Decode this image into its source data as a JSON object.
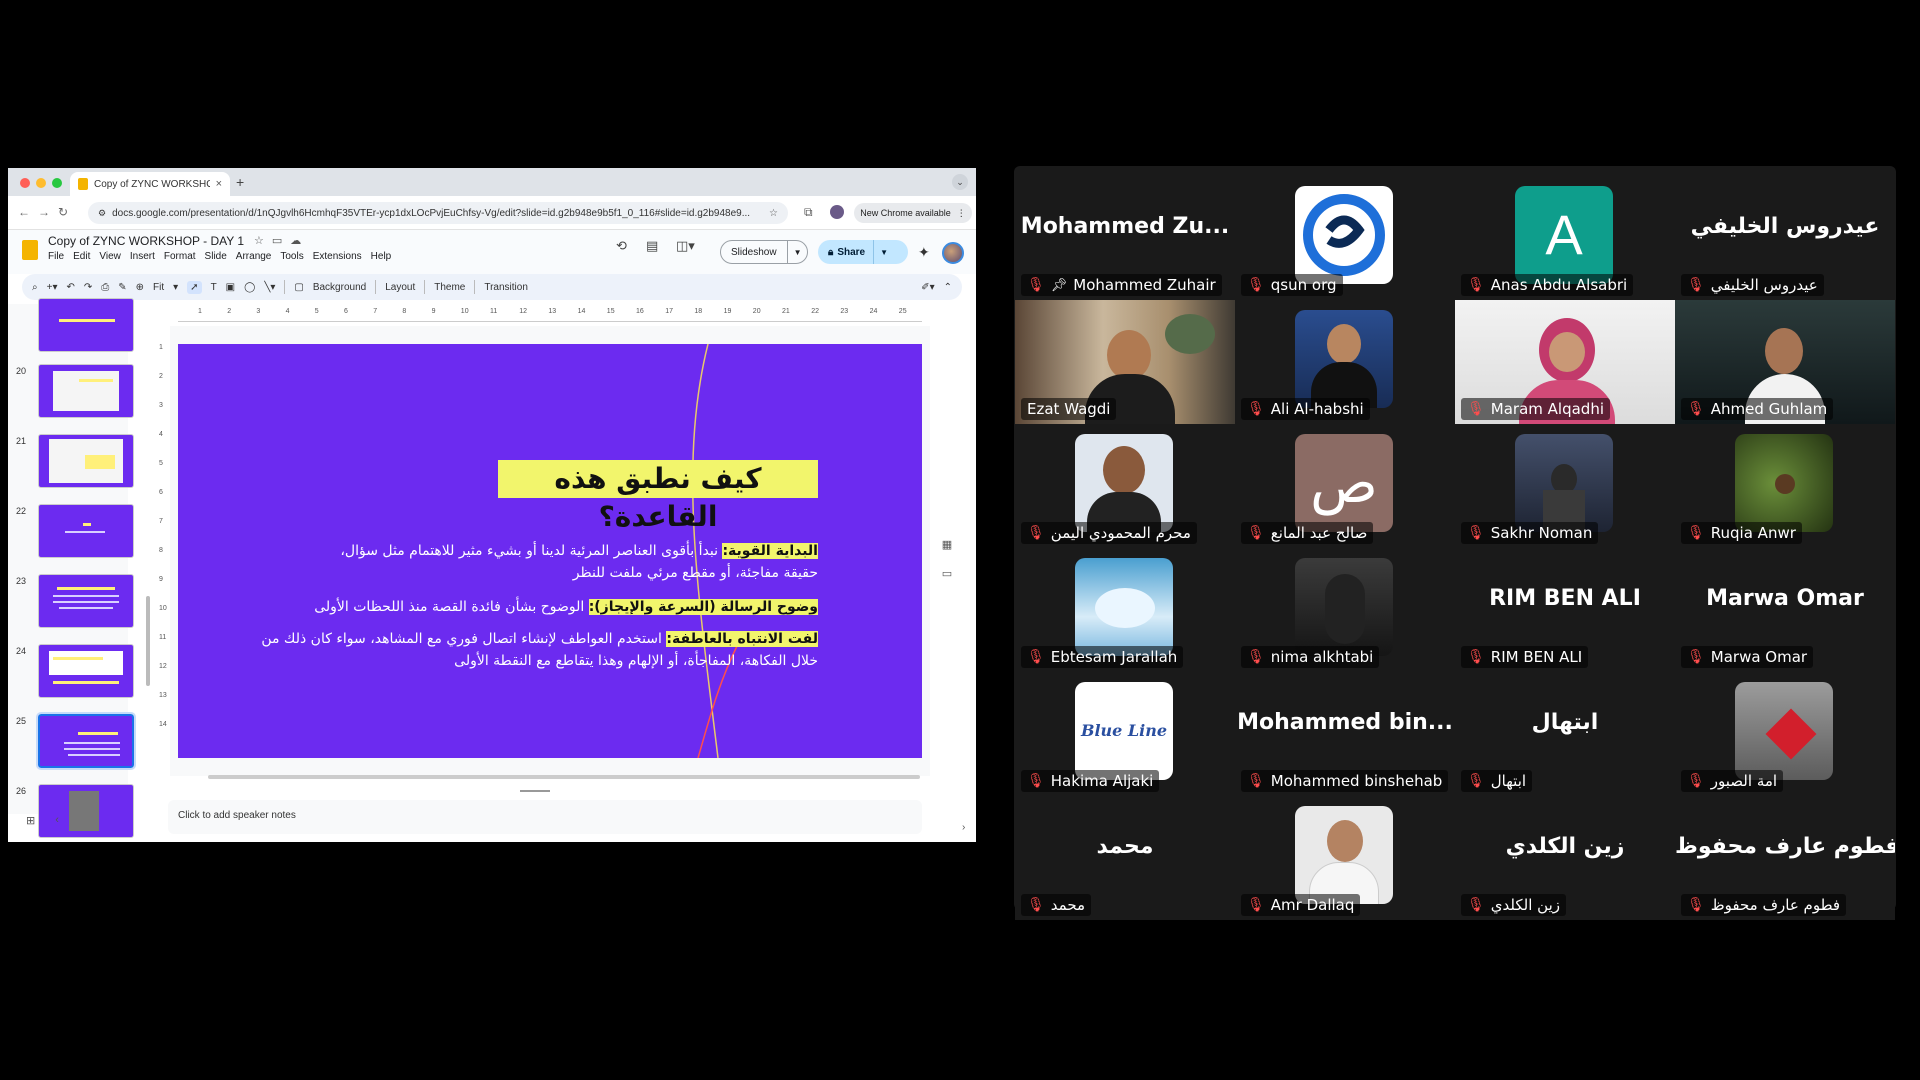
{
  "browser": {
    "tab_title": "Copy of ZYNC WORKSHOP",
    "tab_close": "×",
    "new_tab": "+",
    "url": "docs.google.com/presentation/d/1nQJgvlh6HcmhqF35VTEr-ycp1dxLOcPvjEuChfsy-Vg/edit?slide=id.g2b948e9b5f1_0_116#slide=id.g2b948e9...",
    "update_pill": "New Chrome available",
    "back": "←",
    "forward": "→",
    "reload": "↻"
  },
  "slides_app": {
    "doc_title": "Copy of ZYNC WORKSHOP - DAY 1",
    "menu": [
      "File",
      "Edit",
      "View",
      "Insert",
      "Format",
      "Slide",
      "Arrange",
      "Tools",
      "Extensions",
      "Help"
    ],
    "slideshow_label": "Slideshow",
    "share_label": "Share",
    "toolbar": {
      "zoom": "Fit",
      "background": "Background",
      "layout": "Layout",
      "theme": "Theme",
      "transition": "Transition"
    },
    "ruler_h": [
      "1",
      "2",
      "3",
      "4",
      "5",
      "6",
      "7",
      "8",
      "9",
      "10",
      "11",
      "12",
      "13",
      "14",
      "15",
      "16",
      "17",
      "18",
      "19",
      "20",
      "21",
      "22",
      "23",
      "24",
      "25"
    ],
    "ruler_v": [
      "1",
      "2",
      "3",
      "4",
      "5",
      "6",
      "7",
      "8",
      "9",
      "10",
      "11",
      "12",
      "13",
      "14"
    ],
    "thumb_numbers": [
      "20",
      "21",
      "22",
      "23",
      "24",
      "25",
      "26"
    ],
    "active_thumb": "25",
    "notes_placeholder": "Click to add speaker notes",
    "slide": {
      "title": "كيف نطبق هذه القاعدة؟",
      "b1_label": "البداية القوية:",
      "b1_text": " نبدأ بأقوى العناصر المرئية لدينا أو بشيء مثير للاهتمام مثل سؤال،",
      "b1_text2": "حقيقة مفاجئة، أو مقطع مرئي ملفت للنظر",
      "b2_label": "وضوح الرسالة (السرعة والإيجاز):",
      "b2_text": " الوضوح بشأن فائدة القصة منذ اللحظات الأولى",
      "b3_label": "لفت الانتباه بالعاطفة:",
      "b3_text": " استخدم العواطف لإنشاء اتصال فوري مع المشاهد، سواء كان ذلك من",
      "b3_text2": "خلال الفكاهة، المفاجأة، أو الإلهام وهذا يتقاطع مع النقطة الأولى"
    }
  },
  "participants": [
    {
      "label": "Mohammed Zuhair",
      "display": "Mohammed  Zu...",
      "kind": "name",
      "pinned": true
    },
    {
      "label": "qsun org",
      "kind": "logo-qsun"
    },
    {
      "label": "Anas Abdu Alsabri",
      "kind": "letter",
      "letter": "A"
    },
    {
      "label": "عيدروس الخليفي",
      "display": "عيدروس الخليفي",
      "kind": "name"
    },
    {
      "label": "Ezat Wagdi",
      "kind": "video-ezat",
      "speaking": true,
      "muted": false
    },
    {
      "label": "Ali Al-habshi",
      "kind": "photo-ali"
    },
    {
      "label": "Maram Alqadhi",
      "kind": "video-maram"
    },
    {
      "label": "Ahmed Guhlam",
      "kind": "video-ahmed"
    },
    {
      "label": "محرم المحمودي اليمن",
      "kind": "photo-muharram"
    },
    {
      "label": "صالح عبد المانع",
      "kind": "letter-ar",
      "letter": "ص"
    },
    {
      "label": "Sakhr Noman",
      "kind": "photo-sakhr"
    },
    {
      "label": "Ruqia Anwr",
      "kind": "photo-ruqia"
    },
    {
      "label": "Ebtesam Jarallah",
      "kind": "photo-sky"
    },
    {
      "label": "nima alkhtabi",
      "kind": "photo-nima"
    },
    {
      "label": "RIM BEN ALI",
      "display": "RIM BEN ALI",
      "kind": "name"
    },
    {
      "label": "Marwa Omar",
      "display": "Marwa Omar",
      "kind": "name"
    },
    {
      "label": "Hakima Aljaki",
      "kind": "logo-blueline",
      "logo_text": "Blue Line"
    },
    {
      "label": "Mohammed binshehab",
      "display": "Mohammed  bin...",
      "kind": "name"
    },
    {
      "label": "ابتهال",
      "display": "ابتهال",
      "kind": "name"
    },
    {
      "label": "امة الصبور",
      "kind": "photo-heart"
    },
    {
      "label": "محمد",
      "display": "محمد",
      "kind": "name"
    },
    {
      "label": "Amr Dallaq",
      "kind": "photo-amr"
    },
    {
      "label": "زين الكلدي",
      "display": "زين الكلدي",
      "kind": "name"
    },
    {
      "label": "فطوم عارف محفوظ",
      "display": "فطوم عارف محفوظ",
      "kind": "name"
    }
  ]
}
